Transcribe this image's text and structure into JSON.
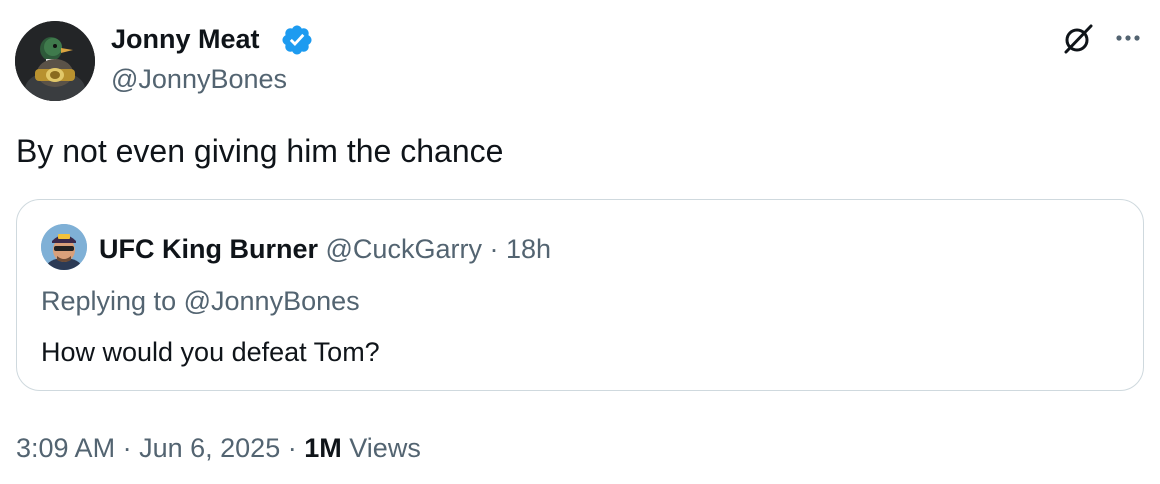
{
  "author": {
    "name": "Jonny Meat",
    "handle": "@JonnyBones",
    "verified": true,
    "verified_color": "#1d9bf0"
  },
  "icons": {
    "grok": "grok-icon",
    "more": "more-icon"
  },
  "tweet": {
    "text": "By not even giving him the chance"
  },
  "quoted": {
    "name": "UFC King Burner",
    "handle": "@CuckGarry",
    "separator": "·",
    "time": "18h",
    "replying_label": "Replying to",
    "replying_handle": "@JonnyBones",
    "text": "How would you defeat Tom?"
  },
  "meta": {
    "time": "3:09 AM",
    "sep1": "·",
    "date": "Jun 6, 2025",
    "sep2": "·",
    "views_count": "1M",
    "views_label": "Views"
  }
}
